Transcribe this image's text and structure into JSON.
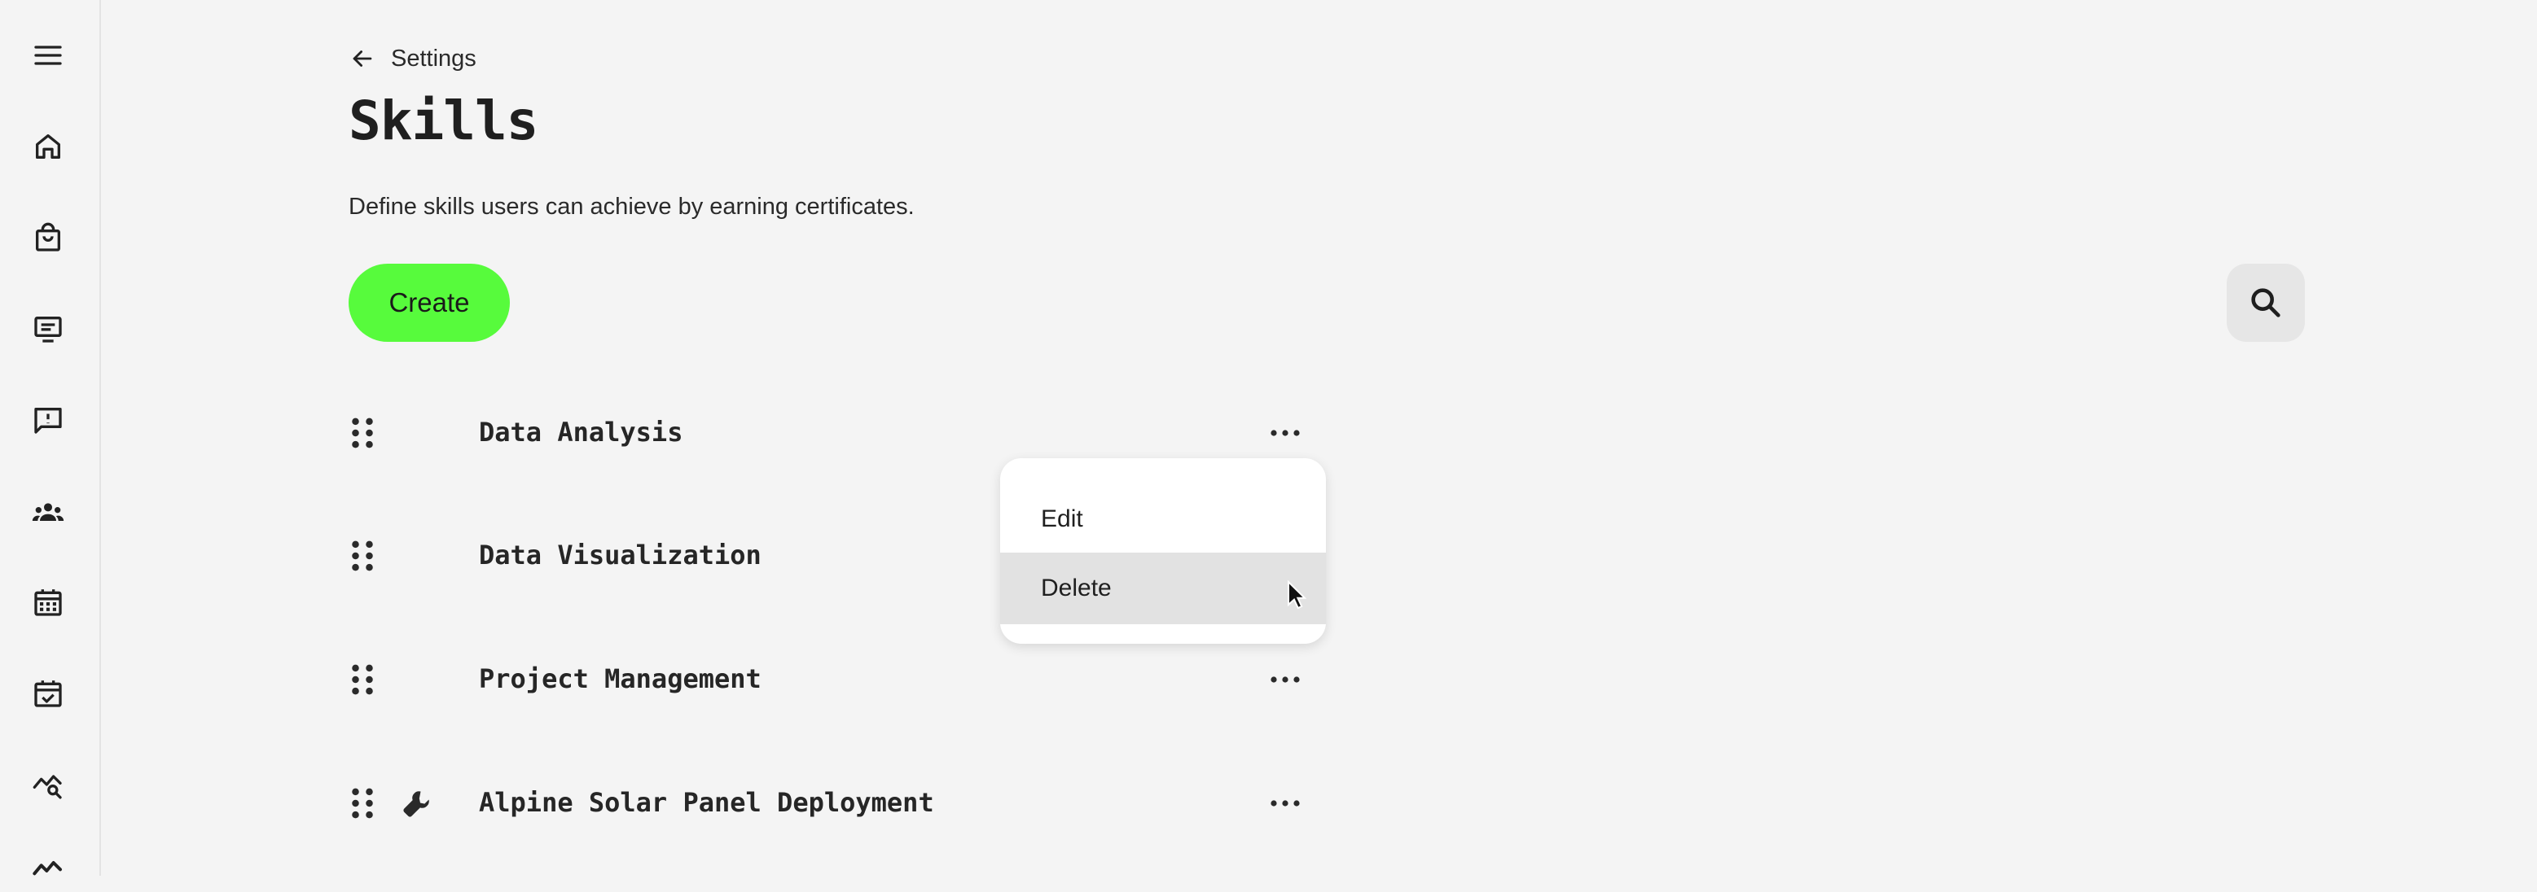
{
  "sidebar": {
    "items": [
      {
        "icon": "menu-icon"
      },
      {
        "icon": "home-icon"
      },
      {
        "icon": "shopping-bag-icon"
      },
      {
        "icon": "presentation-icon"
      },
      {
        "icon": "feedback-icon"
      },
      {
        "icon": "groups-icon"
      },
      {
        "icon": "calendar-grid-icon"
      },
      {
        "icon": "calendar-check-icon"
      },
      {
        "icon": "analytics-search-icon"
      },
      {
        "icon": "trend-icon"
      }
    ]
  },
  "header": {
    "back_label": "Settings",
    "title": "Skills",
    "subtitle": "Define skills users can achieve by earning certificates."
  },
  "toolbar": {
    "create_label": "Create",
    "search_icon": "search-icon"
  },
  "skills": [
    {
      "label": "Data Analysis",
      "icon": ""
    },
    {
      "label": "Data Visualization",
      "icon": ""
    },
    {
      "label": "Project Management",
      "icon": ""
    },
    {
      "label": "Alpine Solar Panel Deployment",
      "icon": "wrench-icon"
    }
  ],
  "context_menu": {
    "items": [
      {
        "label": "Edit",
        "state": "normal"
      },
      {
        "label": "Delete",
        "state": "hover"
      }
    ]
  },
  "colors": {
    "accent": "#57fb3c",
    "background": "#f4f4f4",
    "menu_hover": "#e2e2e2"
  }
}
